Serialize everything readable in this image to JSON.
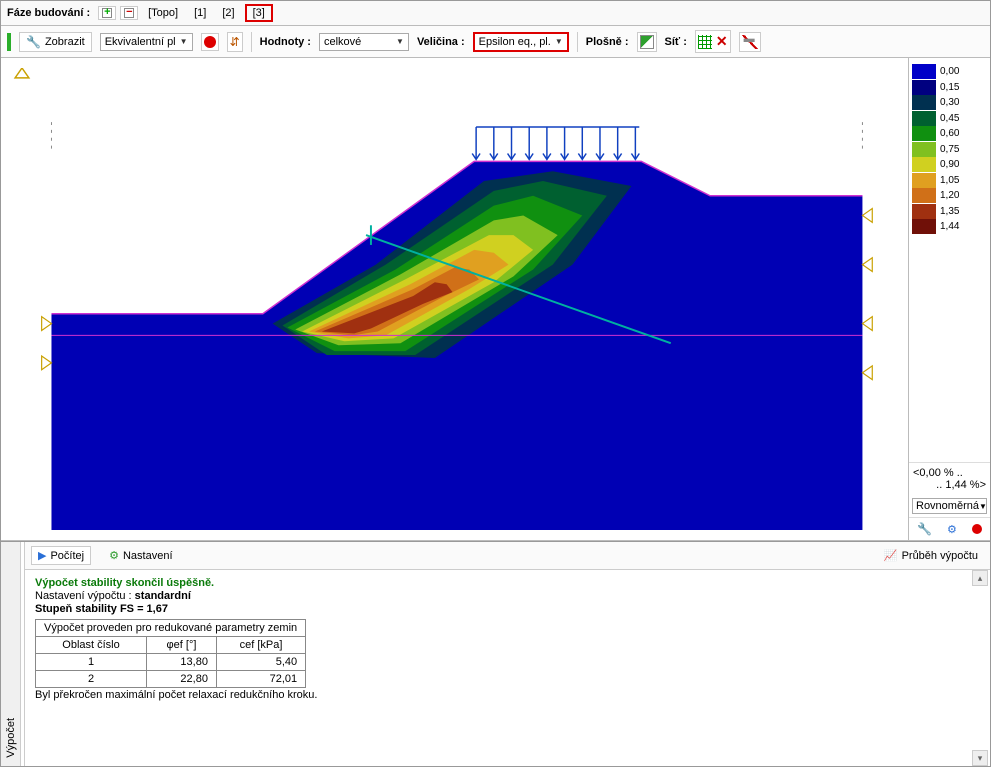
{
  "topbar": {
    "label": "Fáze budování :",
    "phases": [
      "[Topo]",
      "[1]",
      "[2]",
      "[3]"
    ],
    "active_phase": "[3]"
  },
  "toolbar": {
    "zobrazit": "Zobrazit",
    "ekvivalentni": "Ekvivalentní pl",
    "hodnoty": "Hodnoty :",
    "hodnoty_val": "celkové",
    "velicina": "Veličina :",
    "velicina_val": "Epsilon eq., pl.",
    "plosne": "Plošně :",
    "sit": "Síť :"
  },
  "legend": {
    "items": [
      {
        "color": "#0000c8",
        "val": "0,00"
      },
      {
        "color": "#000080",
        "val": "0,15"
      },
      {
        "color": "#003050",
        "val": "0,30"
      },
      {
        "color": "#006030",
        "val": "0,45"
      },
      {
        "color": "#109010",
        "val": "0,60"
      },
      {
        "color": "#80c020",
        "val": "0,75"
      },
      {
        "color": "#d0d020",
        "val": "0,90"
      },
      {
        "color": "#e0a020",
        "val": "1,05"
      },
      {
        "color": "#d07018",
        "val": "1,20"
      },
      {
        "color": "#a03010",
        "val": "1,35"
      },
      {
        "color": "#701008",
        "val": "1,44"
      }
    ],
    "range": "<0,00 % ..",
    "range2": ".. 1,44 %>",
    "mode": "Rovnoměrná"
  },
  "bottom": {
    "tab": "Výpočet",
    "pocitej": "Počítej",
    "nastaveni": "Nastavení",
    "prubeh": "Průběh výpočtu",
    "success": "Výpočet stability skončil úspěšně.",
    "nast_label": "Nastavení výpočtu :",
    "nast_val": "standardní",
    "stupen": "Stupeň stability FS = 1,67",
    "table_caption": "Výpočet proveden pro redukované parametry zemin",
    "h1": "Oblast číslo",
    "h2": "φef [°]",
    "h3": "cef [kPa]",
    "rows": [
      {
        "n": "1",
        "phi": "13,80",
        "c": "5,40"
      },
      {
        "n": "2",
        "phi": "22,80",
        "c": "72,01"
      }
    ],
    "footer_note": "Byl překročen maximální počet relaxací redukčního kroku."
  },
  "chart_data": {
    "type": "heatmap",
    "title": "Epsilon eq., pl. (equivalent plastic strain) contour, slope stability analysis, phase [3]",
    "value_range_pct": [
      0.0,
      1.44
    ],
    "legend_ticks": [
      0.0,
      0.15,
      0.3,
      0.45,
      0.6,
      0.75,
      0.9,
      1.05,
      1.2,
      1.35,
      1.44
    ],
    "units": "%",
    "geometry": "2D embankment slope cross-section with applied surcharge arrows on crest and fixed base/side supports",
    "computed": {
      "FS": 1.67,
      "setting": "standardní"
    }
  }
}
